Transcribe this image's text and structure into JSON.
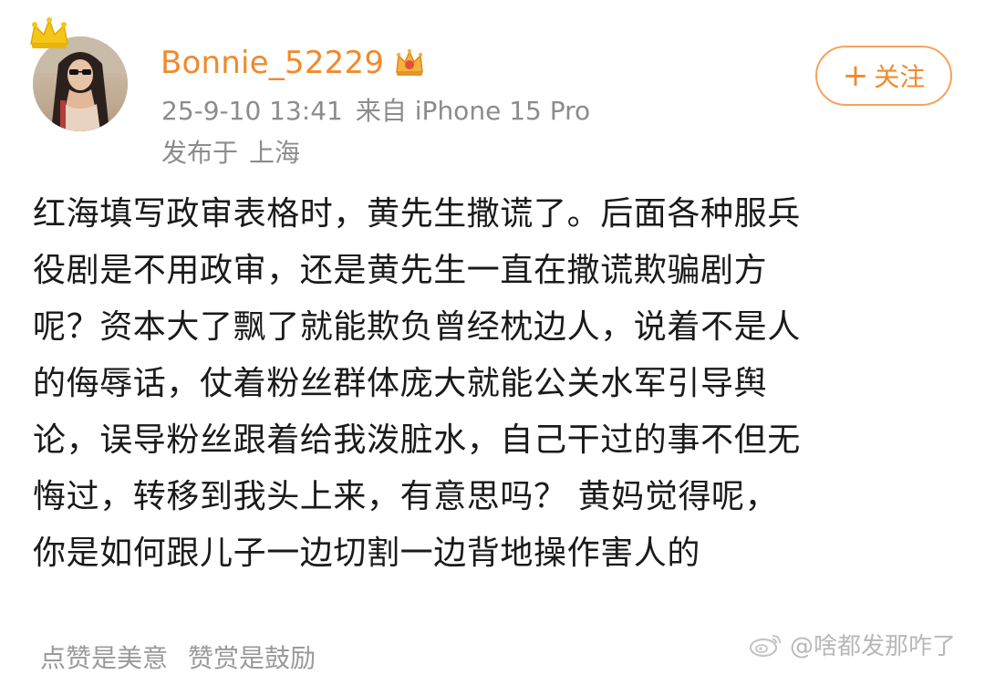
{
  "post": {
    "author": {
      "username": "Bonnie_52229",
      "avatar_icon": "avatar-photo",
      "crown_icon": "crown-icon",
      "badge_icon": "vip-crown-badge-icon"
    },
    "timestamp": "25-9-10 13:41",
    "source": "来自 iPhone 15 Pro",
    "location_prefix": "发布于",
    "location": "上海",
    "follow_button": {
      "plus": "+",
      "label": "关注"
    },
    "content_lines": [
      "红海填写政审表格时，黄先生撒谎了。后面各种服兵",
      "役剧是不用政审，还是黄先生一直在撒谎欺骗剧方",
      "呢？资本大了飘了就能欺负曾经枕边人，说着不是人",
      "的侮辱话，仗着粉丝群体庞大就能公关水军引导舆",
      "论，误导粉丝跟着给我泼脏水，自己干过的事不但无",
      "悔过，转移到我头上来，有意思吗？ 黄妈觉得呢，",
      "你是如何跟儿子一边切割一边背地操作害人的"
    ],
    "footer": {
      "like_hint": "点赞是美意",
      "reward_hint": "赞赏是鼓励"
    }
  },
  "watermark": {
    "text": "@啥都发那咋了",
    "logo_icon": "weibo-logo-icon"
  },
  "colors": {
    "accent": "#f08a2c",
    "follow_border": "#f5a35c",
    "meta_text": "#8c8c8c",
    "body_text": "#1a1a1a"
  }
}
